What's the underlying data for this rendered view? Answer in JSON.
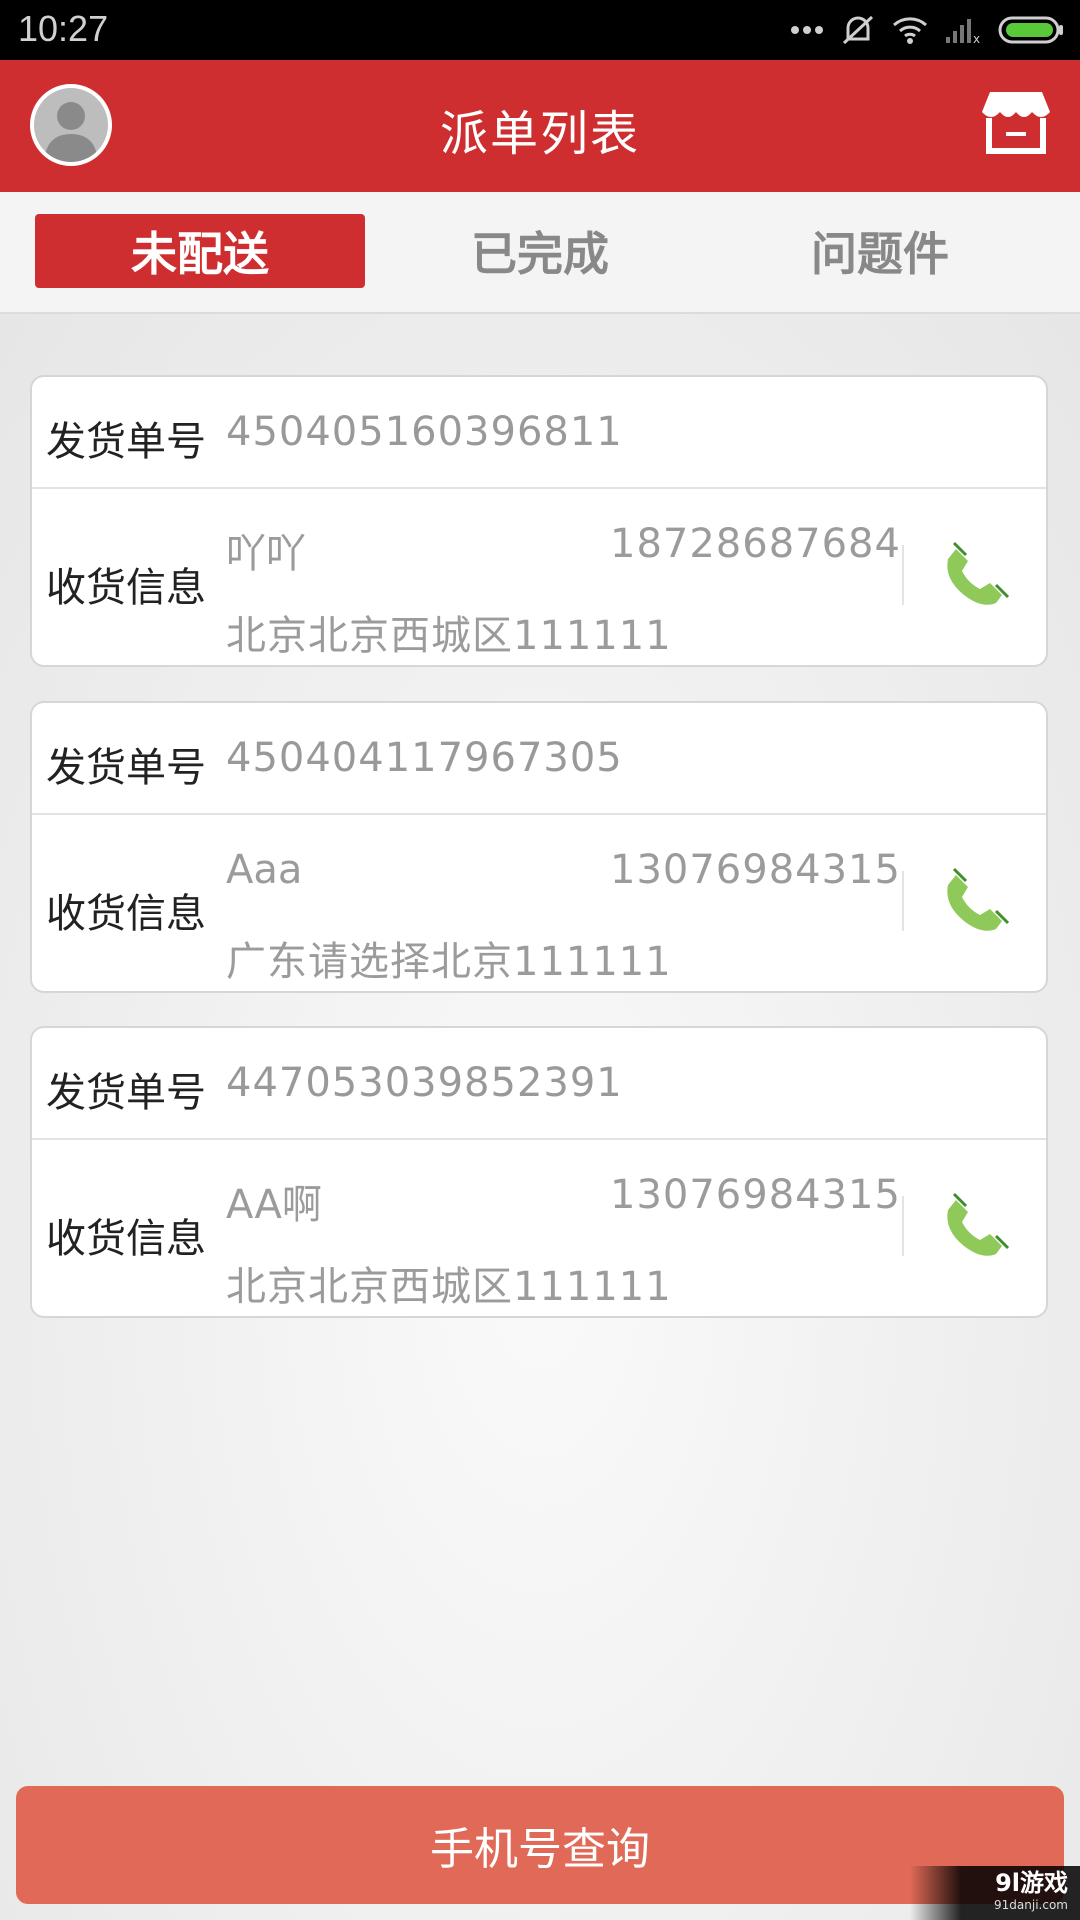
{
  "status_bar": {
    "time": "10:27"
  },
  "app_bar": {
    "title": "派单列表"
  },
  "tabs": [
    {
      "label": "未配送",
      "active": true
    },
    {
      "label": "已完成",
      "active": false
    },
    {
      "label": "问题件",
      "active": false
    }
  ],
  "orders": [
    {
      "order_label": "发货单号",
      "order_no": "450405160396811",
      "info_label": "收货信息",
      "name": "吖吖",
      "phone": "18728687684",
      "address": "北京北京西城区111111"
    },
    {
      "order_label": "发货单号",
      "order_no": "450404117967305",
      "info_label": "收货信息",
      "name": "Aaa",
      "phone": "13076984315",
      "address": "广东请选择北京111111"
    },
    {
      "order_label": "发货单号",
      "order_no": "447053039852391",
      "info_label": "收货信息",
      "name": "AA啊",
      "phone": "13076984315",
      "address": "北京北京西城区111111"
    }
  ],
  "bottom_button": {
    "label": "手机号查询"
  },
  "watermark": {
    "line1": "9l游戏",
    "line2": "91danji.com"
  },
  "colors": {
    "brand_red": "#cf2e30",
    "button_salmon": "#e06a57",
    "call_green": "#8fc95a"
  },
  "icons": [
    "avatar",
    "store-icon",
    "phone-call-icon",
    "wifi-icon",
    "signal-icon",
    "battery-icon",
    "mute-icon"
  ]
}
